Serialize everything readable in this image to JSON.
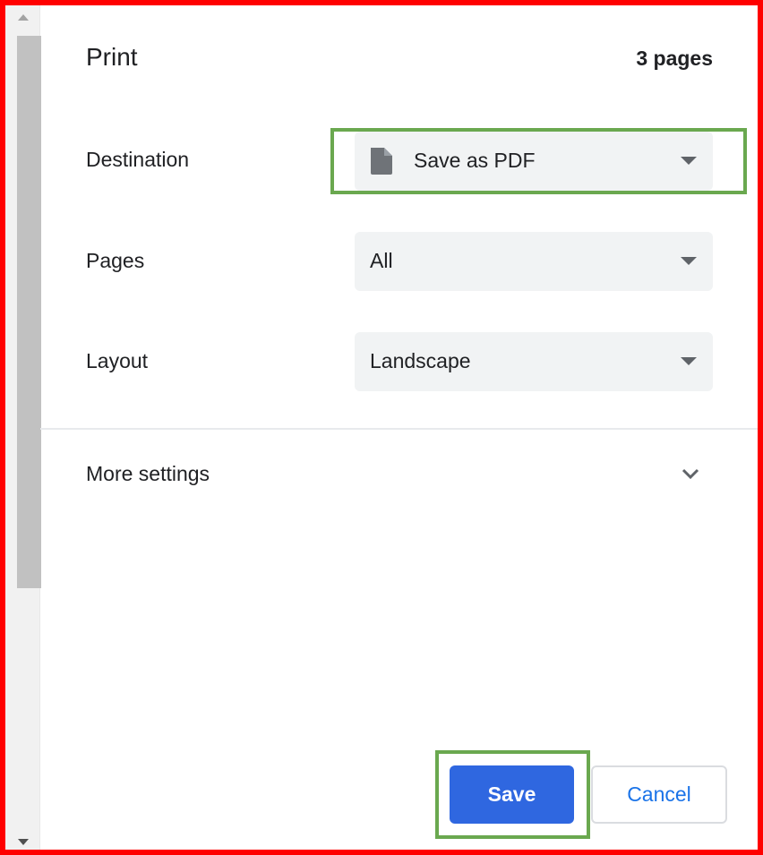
{
  "dialog": {
    "title": "Print",
    "page_count": "3 pages"
  },
  "destination": {
    "label": "Destination",
    "value": "Save as PDF",
    "icon": "document-icon"
  },
  "pages": {
    "label": "Pages",
    "value": "All"
  },
  "layout": {
    "label": "Layout",
    "value": "Landscape"
  },
  "more_settings": {
    "label": "More settings",
    "icon": "chevron-down-icon"
  },
  "actions": {
    "save_label": "Save",
    "cancel_label": "Cancel"
  },
  "colors": {
    "primary_button": "#2f67e0",
    "cancel_text": "#1a73e8",
    "highlight_border": "#6aa84f",
    "frame_border": "#ff0000",
    "select_background": "#f1f3f4"
  }
}
